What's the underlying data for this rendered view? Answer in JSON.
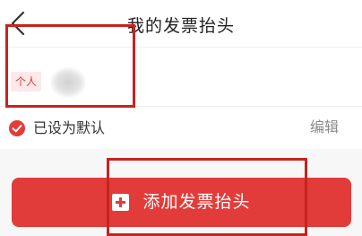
{
  "header": {
    "title": "我的发票抬头",
    "back_icon": "chevron-left-icon"
  },
  "invoice_header": {
    "type_badge": "个人",
    "is_default_label": "已设为默认",
    "edit_label": "编辑",
    "check_icon": "check-circle-icon"
  },
  "add_button": {
    "label": "添加发票抬头",
    "icon": "plus-square-icon"
  },
  "colors": {
    "accent": "#e23c3a",
    "badge_bg": "#fde9e9",
    "annotation": "#c8231f",
    "background": "#f7f7f7"
  }
}
